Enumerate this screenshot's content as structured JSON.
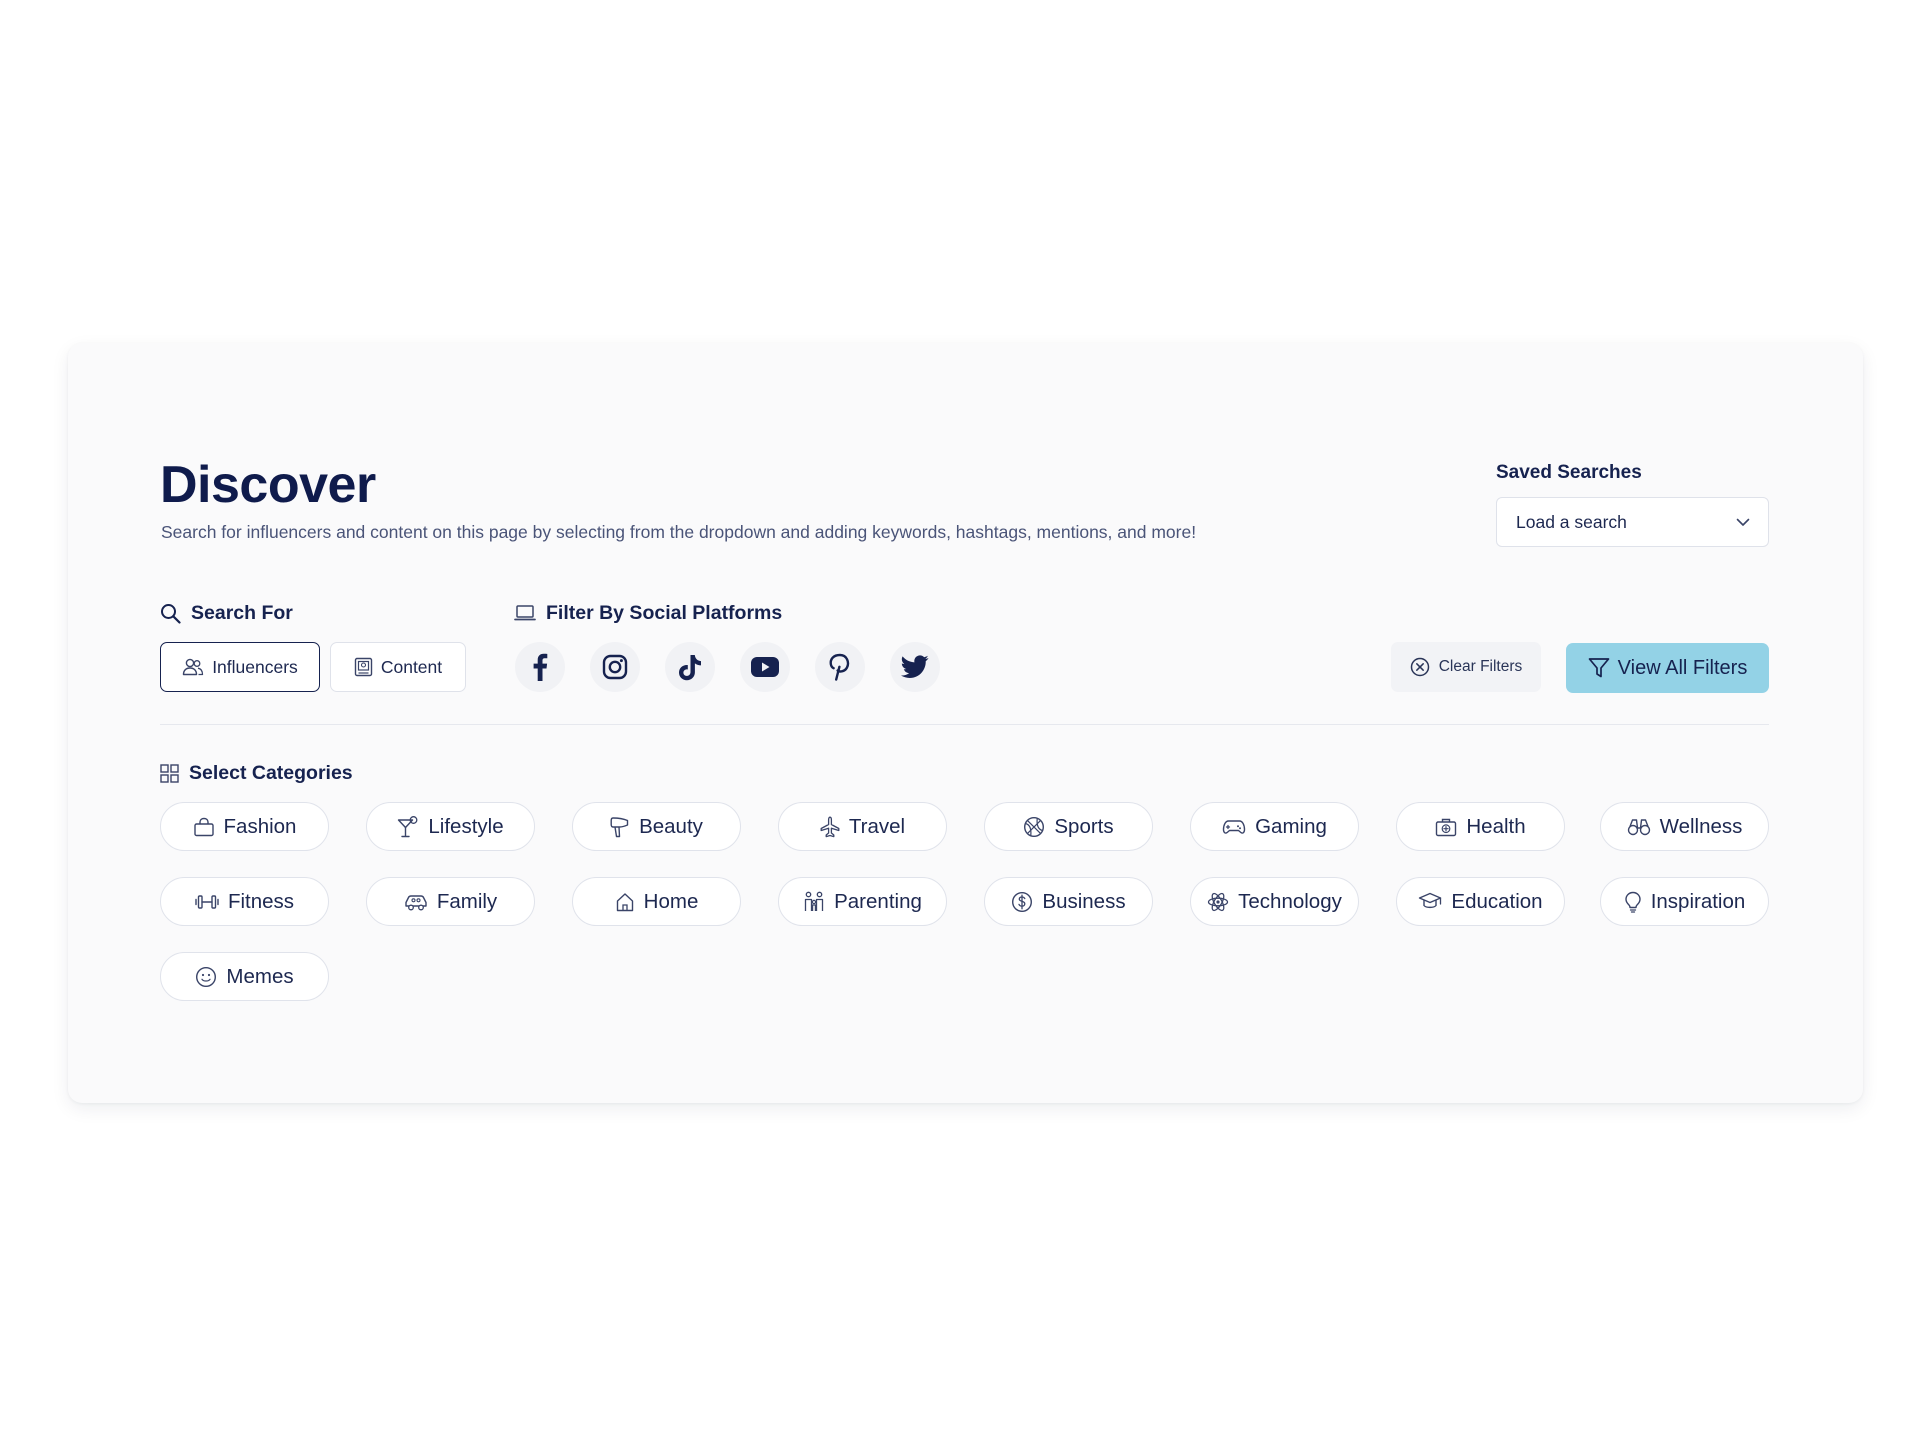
{
  "header": {
    "title": "Discover",
    "description": "Search for influencers and content on this page by selecting from the dropdown and adding keywords, hashtags, mentions, and more!"
  },
  "saved_searches": {
    "label": "Saved Searches",
    "selected": "Load a search"
  },
  "search_for": {
    "label": "Search For",
    "options": [
      {
        "label": "Influencers",
        "icon": "users-icon",
        "active": true
      },
      {
        "label": "Content",
        "icon": "image-icon",
        "active": false
      }
    ]
  },
  "social_platforms": {
    "label": "Filter By Social Platforms",
    "platforms": [
      "facebook-icon",
      "instagram-icon",
      "tiktok-icon",
      "youtube-icon",
      "pinterest-icon",
      "twitter-icon"
    ]
  },
  "actions": {
    "clear_filters": "Clear Filters",
    "view_all_filters": "View All Filters"
  },
  "categories": {
    "label": "Select Categories",
    "items": [
      {
        "label": "Fashion",
        "icon": "shopping-bag-icon"
      },
      {
        "label": "Lifestyle",
        "icon": "cocktail-icon"
      },
      {
        "label": "Beauty",
        "icon": "hair-dryer-icon"
      },
      {
        "label": "Travel",
        "icon": "airplane-icon"
      },
      {
        "label": "Sports",
        "icon": "basketball-icon"
      },
      {
        "label": "Gaming",
        "icon": "gamepad-icon"
      },
      {
        "label": "Health",
        "icon": "first-aid-kit-icon"
      },
      {
        "label": "Wellness",
        "icon": "binoculars-icon"
      },
      {
        "label": "Fitness",
        "icon": "dumbbell-icon"
      },
      {
        "label": "Family",
        "icon": "car-icon"
      },
      {
        "label": "Home",
        "icon": "home-icon"
      },
      {
        "label": "Parenting",
        "icon": "parent-child-icon"
      },
      {
        "label": "Business",
        "icon": "dollar-coin-icon"
      },
      {
        "label": "Technology",
        "icon": "atom-icon"
      },
      {
        "label": "Education",
        "icon": "graduation-cap-icon"
      },
      {
        "label": "Inspiration",
        "icon": "lightbulb-icon"
      },
      {
        "label": "Memes",
        "icon": "smiley-icon"
      }
    ]
  },
  "colors": {
    "primary_text": "#16224f",
    "accent_button": "#93d2e6",
    "card_background": "#fafafb"
  }
}
